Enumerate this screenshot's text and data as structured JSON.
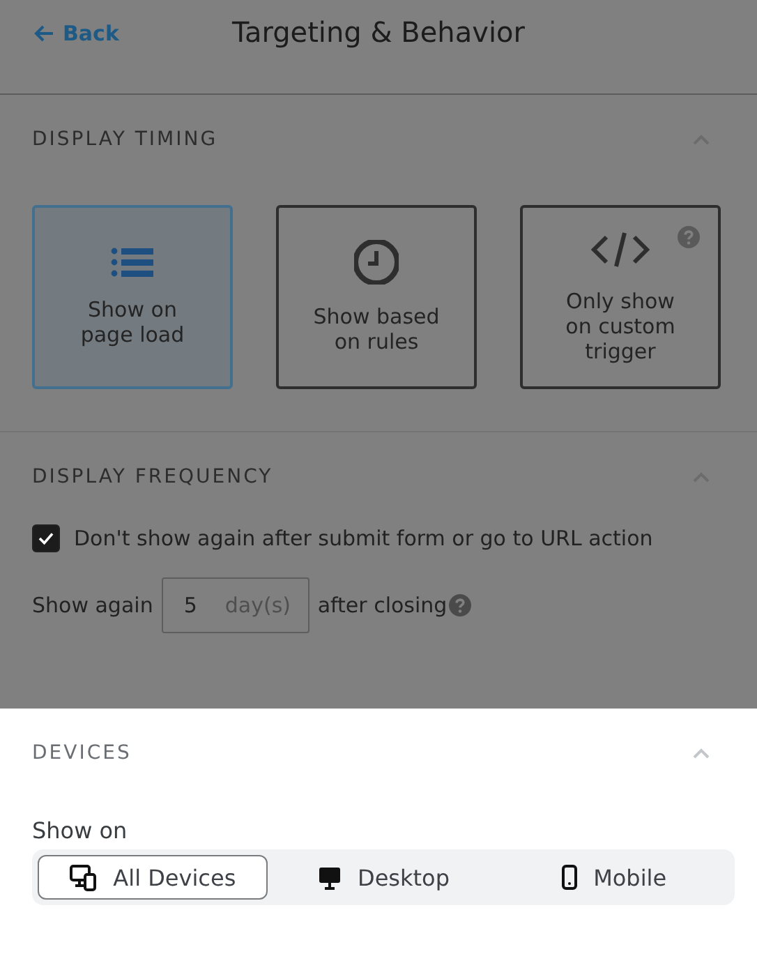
{
  "header": {
    "back": "Back",
    "title": "Targeting & Behavior"
  },
  "display_timing": {
    "title": "DISPLAY TIMING",
    "expanded": true,
    "options": [
      {
        "label": "Show on page load",
        "kind": "list",
        "selected": true,
        "help": false
      },
      {
        "label": "Show based on rules",
        "kind": "clock",
        "selected": false,
        "help": false
      },
      {
        "label": "Only show on custom trigger",
        "kind": "code",
        "selected": false,
        "help": true
      }
    ]
  },
  "display_frequency": {
    "title": "DISPLAY FREQUENCY",
    "expanded": true,
    "checkbox": {
      "label": "Don't show again after submit form or go to URL action",
      "checked": true
    },
    "show_again": {
      "before": "Show again",
      "value": "5",
      "unit": "day(s)",
      "after": "after closing"
    }
  },
  "devices": {
    "title": "DEVICES",
    "expanded": true,
    "label": "Show on",
    "options": [
      {
        "label": "All Devices",
        "kind": "all",
        "selected": true
      },
      {
        "label": "Desktop",
        "kind": "desktop",
        "selected": false
      },
      {
        "label": "Mobile",
        "kind": "mobile",
        "selected": false
      }
    ]
  }
}
